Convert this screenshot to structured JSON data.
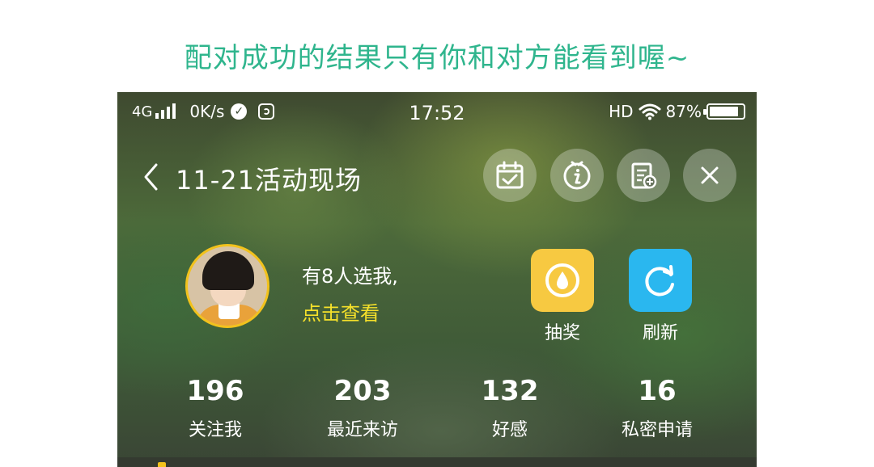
{
  "caption": "配对成功的结果只有你和对方能看到喔~",
  "status_bar": {
    "network": "4G",
    "speed": "0K/s",
    "time": "17:52",
    "hd": "HD",
    "battery": "87%",
    "battery_level": 0.87,
    "signal_bars": 4
  },
  "header": {
    "title": "11-21活动现场",
    "buttons": [
      "calendar-check-icon",
      "info-icon",
      "clipboard-add-icon",
      "close-icon"
    ]
  },
  "profile": {
    "message": "有8人选我,",
    "link": "点击查看"
  },
  "actions": [
    {
      "label": "抽奖",
      "icon": "drop-icon",
      "color": "#f7c941"
    },
    {
      "label": "刷新",
      "icon": "refresh-icon",
      "color": "#2ab7ef"
    }
  ],
  "stats": [
    {
      "value": "196",
      "label": "关注我"
    },
    {
      "value": "203",
      "label": "最近来访"
    },
    {
      "value": "132",
      "label": "好感"
    },
    {
      "value": "16",
      "label": "私密申请"
    }
  ],
  "colors": {
    "caption": "#2fb58d",
    "link": "#f5e02a",
    "avatar_border": "#f2c21c"
  }
}
